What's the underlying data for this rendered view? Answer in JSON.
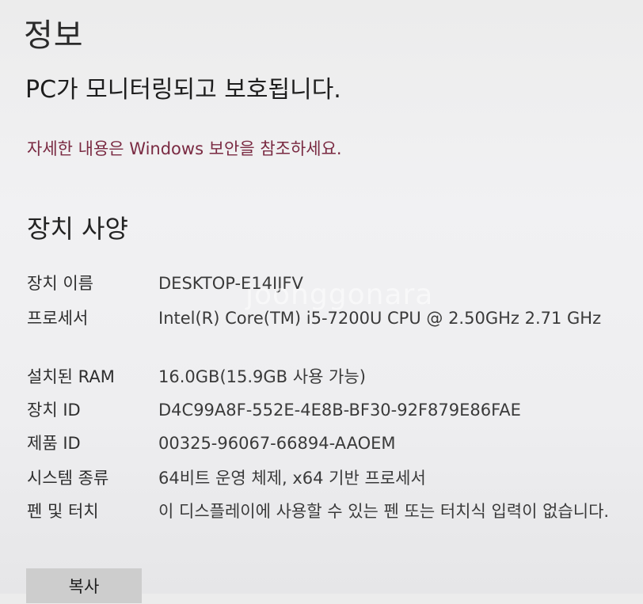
{
  "page": {
    "title": "정보",
    "protection_status": "PC가 모니터링되고 보호됩니다.",
    "security_link": "자세한 내용은 Windows 보안을 참조하세요."
  },
  "device_specs": {
    "heading": "장치 사양",
    "rows": [
      {
        "label": "장치 이름",
        "value": "DESKTOP-E14IJFV"
      },
      {
        "label": "프로세서",
        "value": "Intel(R) Core(TM) i5-7200U CPU @ 2.50GHz   2.71 GHz"
      },
      {
        "label": "설치된 RAM",
        "value": "16.0GB(15.9GB 사용 가능)"
      },
      {
        "label": "장치 ID",
        "value": "D4C99A8F-552E-4E8B-BF30-92F879E86FAE"
      },
      {
        "label": "제품 ID",
        "value": "00325-96067-66894-AAOEM"
      },
      {
        "label": "시스템 종류",
        "value": "64비트 운영 체제, x64 기반 프로세서"
      },
      {
        "label": "펜 및 터치",
        "value": "이 디스플레이에 사용할 수 있는 펜 또는 터치식 입력이 없습니다."
      }
    ],
    "copy_button": "복사"
  },
  "watermark": "joonggonara"
}
